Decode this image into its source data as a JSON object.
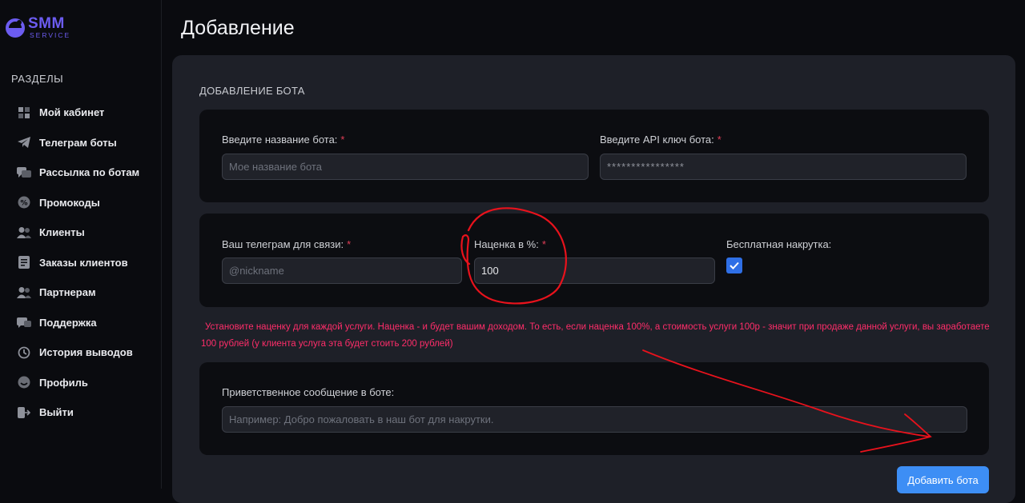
{
  "brand": {
    "main": "SMM",
    "sub": "SERVICE"
  },
  "sidebar": {
    "section_title": "РАЗДЕЛЫ",
    "items": [
      {
        "label": "Мой кабинет",
        "icon": "grid-icon"
      },
      {
        "label": "Телеграм боты",
        "icon": "telegram-icon"
      },
      {
        "label": "Рассылка по ботам",
        "icon": "chat-icon"
      },
      {
        "label": "Промокоды",
        "icon": "discount-icon"
      },
      {
        "label": "Клиенты",
        "icon": "users-icon"
      },
      {
        "label": "Заказы клиентов",
        "icon": "document-icon"
      },
      {
        "label": "Партнерам",
        "icon": "partners-icon"
      },
      {
        "label": "Поддержка",
        "icon": "support-icon"
      },
      {
        "label": "История выводов",
        "icon": "history-icon"
      },
      {
        "label": "Профиль",
        "icon": "profile-icon"
      },
      {
        "label": "Выйти",
        "icon": "logout-icon"
      }
    ]
  },
  "page": {
    "title": "Добавление"
  },
  "form": {
    "title": "ДОБАВЛЕНИЕ БОТА",
    "bot_name": {
      "label": "Введите название бота:",
      "placeholder": "Мое название бота",
      "value": ""
    },
    "api_key": {
      "label": "Введите API ключ бота:",
      "value": "****************"
    },
    "telegram": {
      "label": "Ваш телеграм для связи:",
      "placeholder": "@nickname",
      "value": ""
    },
    "markup": {
      "label": "Наценка в %:",
      "value": "100"
    },
    "free_boost": {
      "label": "Бесплатная накрутка:",
      "checked": true
    },
    "hint_line1": "Установите наценку для каждой услуги. Наценка - и будет вашим доходом. То есть, если наценка 100%, а стоимость услуги 100р - значит при продаже данной услуги, вы заработаете",
    "hint_line2": "100 рублей (у клиента услуга эта будет стоить 200 рублей)",
    "welcome": {
      "label": "Приветственное сообщение в боте:",
      "placeholder": "Например: Добро пожаловать в наш бот для накрутки.",
      "value": ""
    },
    "submit_label": "Добавить бота"
  },
  "colors": {
    "accent": "#3d8ef5",
    "brand": "#6c5cf0",
    "required": "#e23e57",
    "hint": "#ff2d6a",
    "annotation": "#e8121c"
  }
}
